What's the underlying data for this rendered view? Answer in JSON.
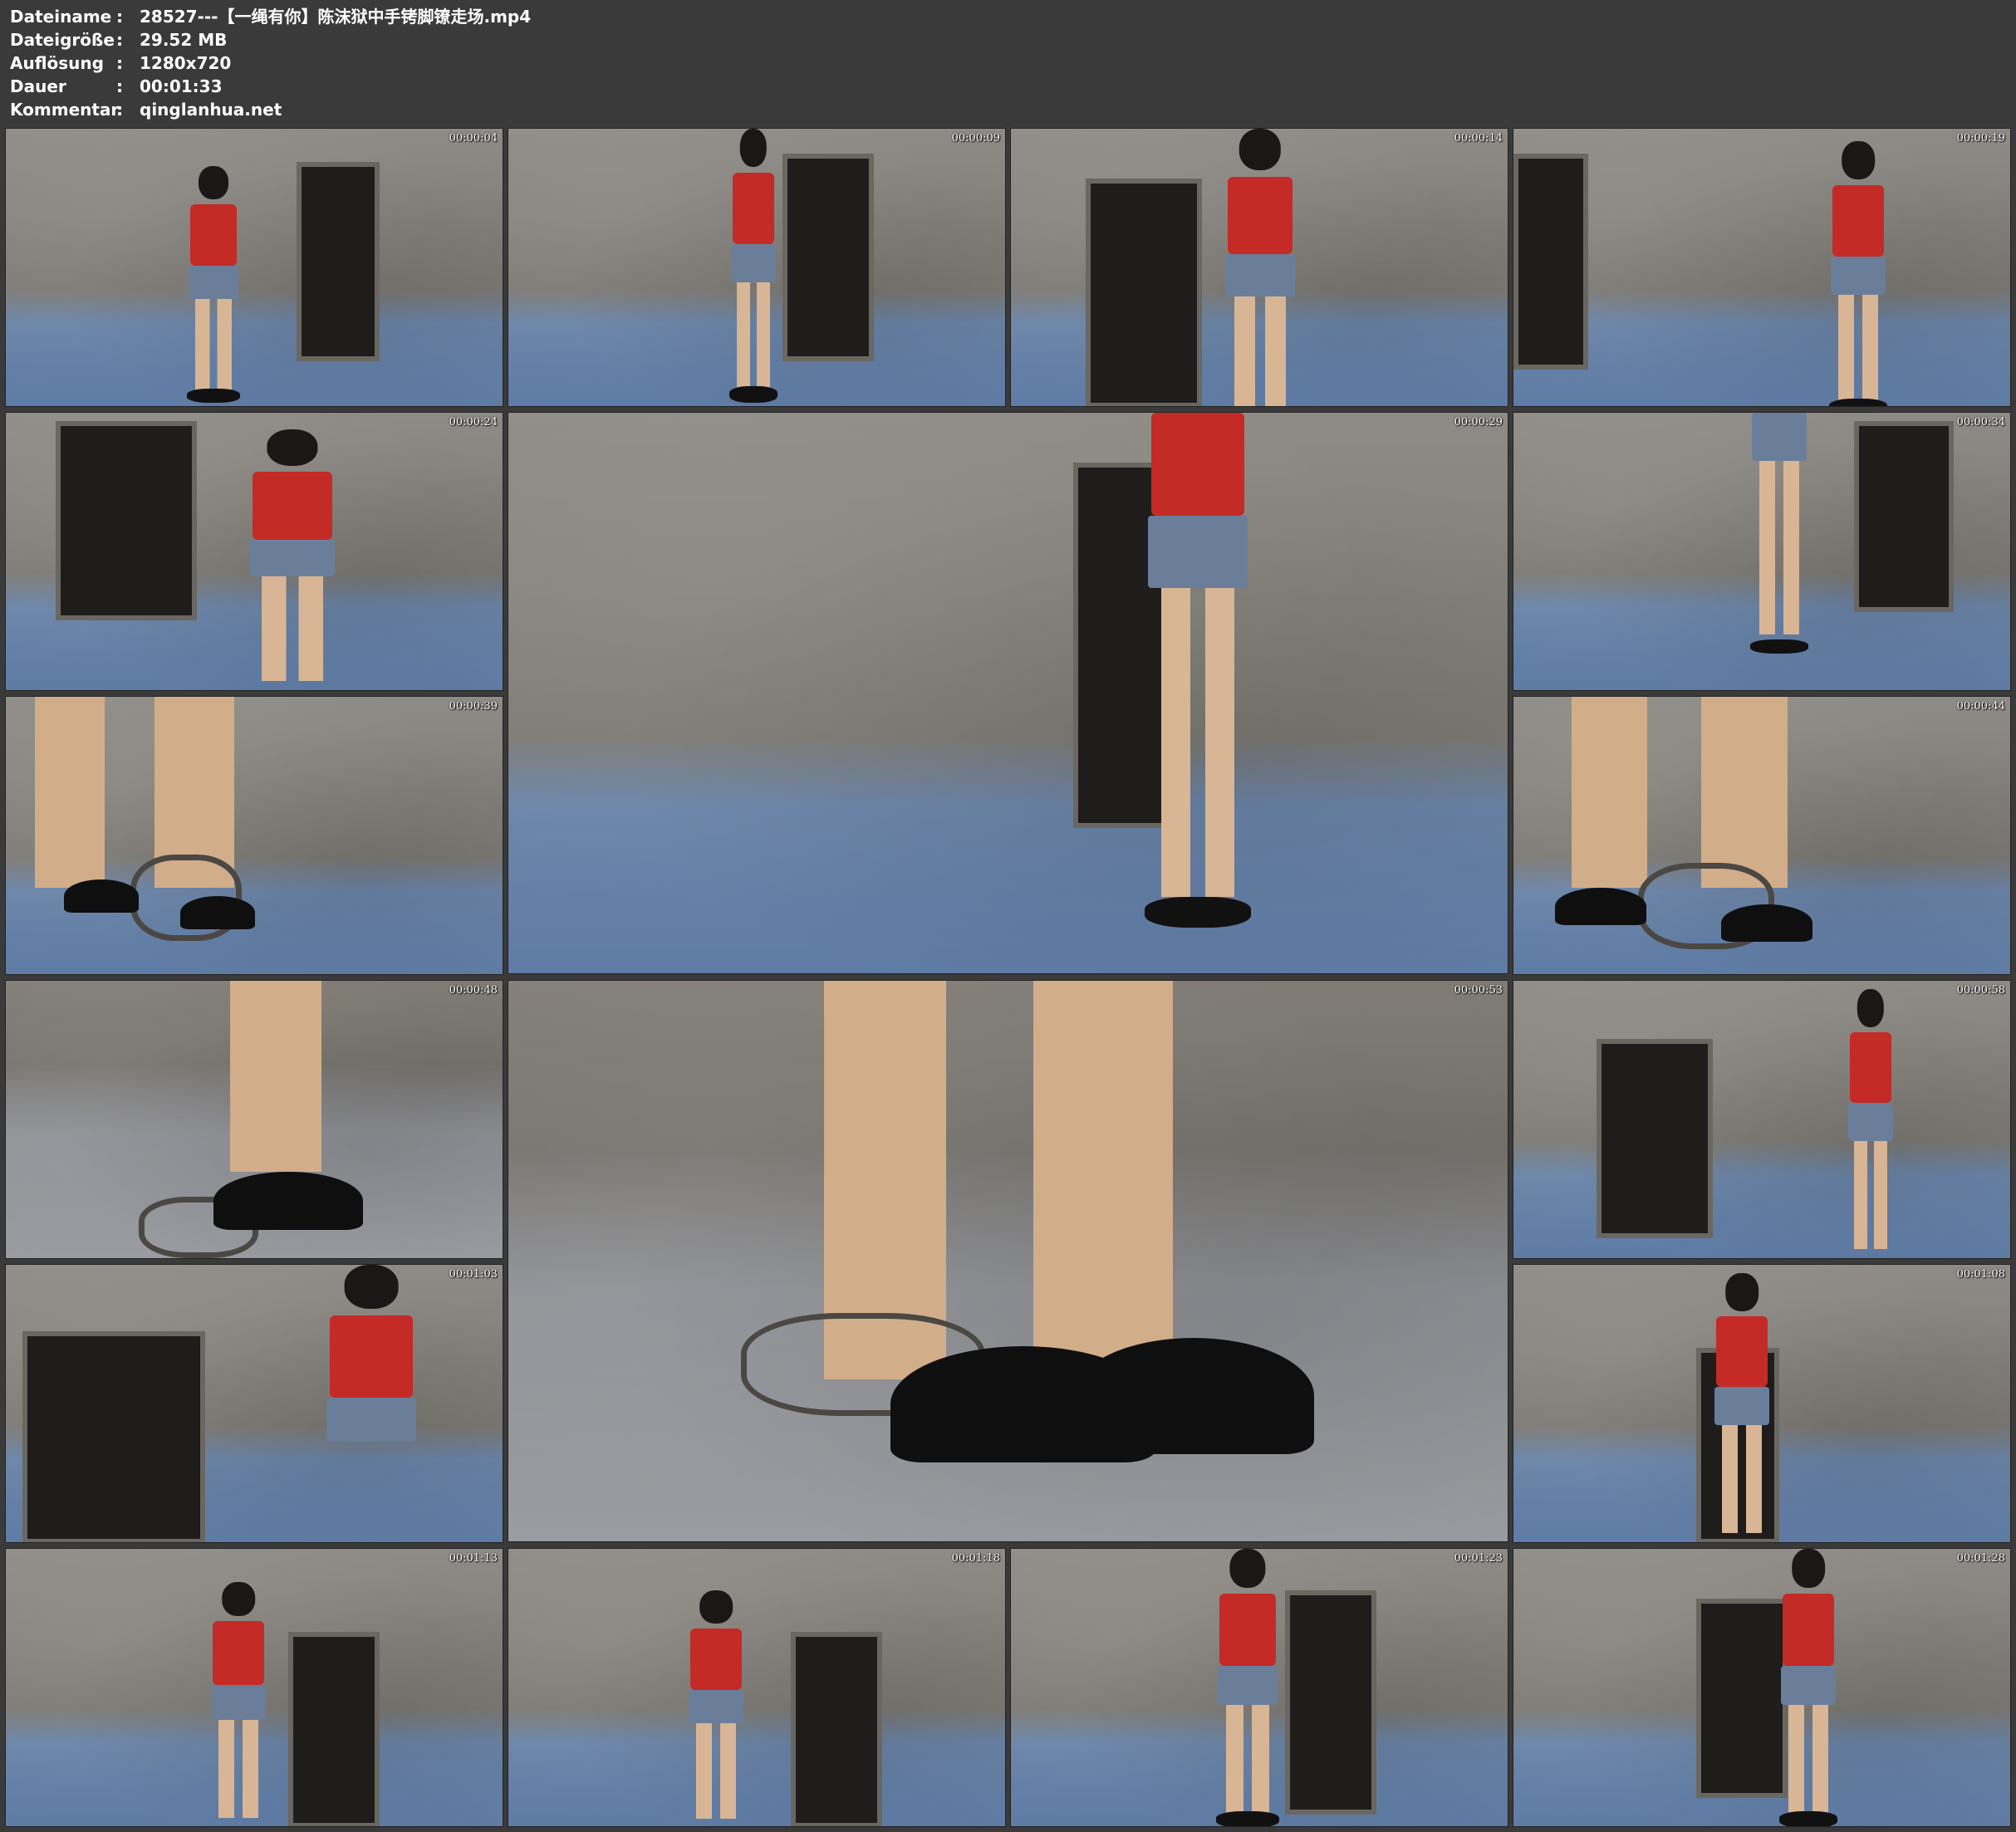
{
  "info": [
    {
      "key": "Dateiname",
      "sep": ":",
      "value": "28527---【一绳有你】陈沫狱中手铐脚镣走场.mp4"
    },
    {
      "key": "Dateigröße",
      "sep": ":",
      "value": "29.52 MB"
    },
    {
      "key": "Auflösung",
      "sep": ":",
      "value": "1280x720"
    },
    {
      "key": "Dauer",
      "sep": ":",
      "value": "00:01:33"
    },
    {
      "key": "Kommentar",
      "sep": ":",
      "value": "qinglanhua.net"
    }
  ],
  "frames": [
    {
      "time": "00:00:04"
    },
    {
      "time": "00:00:09"
    },
    {
      "time": "00:00:14"
    },
    {
      "time": "00:00:19"
    },
    {
      "time": "00:00:24"
    },
    {
      "time": "00:00:29"
    },
    {
      "time": "00:00:34"
    },
    {
      "time": "00:00:39"
    },
    {
      "time": "00:00:44"
    },
    {
      "time": "00:00:48"
    },
    {
      "time": "00:00:53"
    },
    {
      "time": "00:00:58"
    },
    {
      "time": "00:01:03"
    },
    {
      "time": "00:01:08"
    },
    {
      "time": "00:01:13"
    },
    {
      "time": "00:01:18"
    },
    {
      "time": "00:01:23"
    },
    {
      "time": "00:01:28"
    }
  ]
}
